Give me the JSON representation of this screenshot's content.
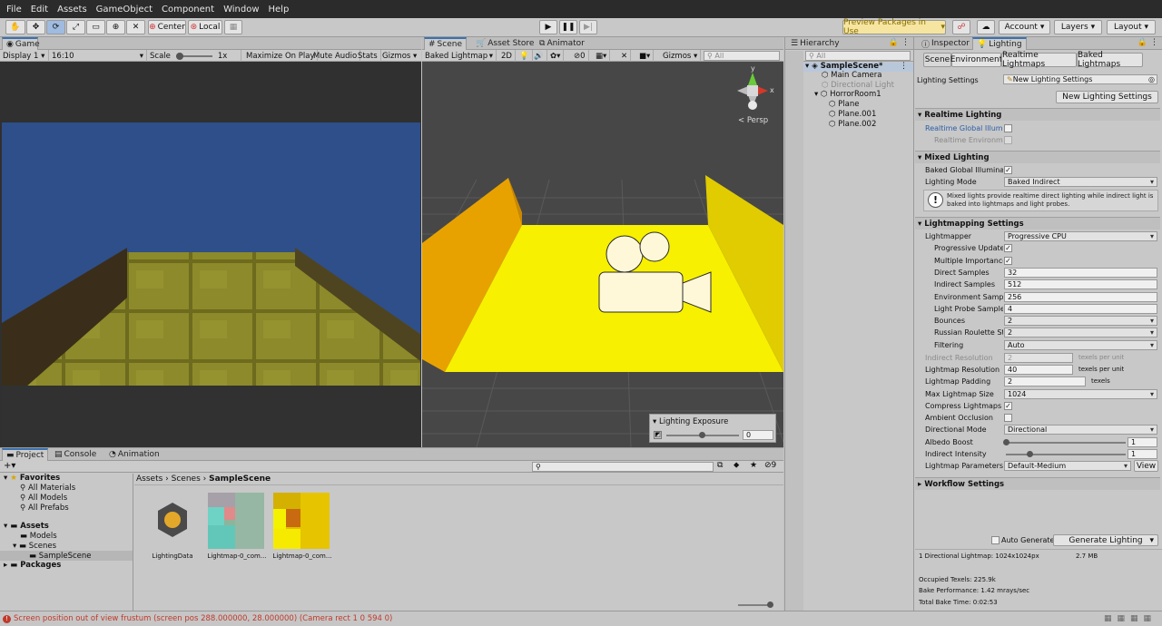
{
  "menu": [
    "File",
    "Edit",
    "Assets",
    "GameObject",
    "Component",
    "Window",
    "Help"
  ],
  "toolbar": {
    "pivot": "Center",
    "space": "Local",
    "preview_packages": "Preview Packages in Use",
    "account": "Account",
    "layers": "Layers",
    "layout": "Layout"
  },
  "game": {
    "tab": "Game",
    "display": "Display 1",
    "aspect": "16:10",
    "scale_label": "Scale",
    "scale_value": "1x",
    "maximize": "Maximize On Play",
    "mute": "Mute Audio",
    "stats": "Stats",
    "gizmos": "Gizmos"
  },
  "scene": {
    "tabs": [
      "Scene",
      "Asset Store",
      "Animator"
    ],
    "draw_mode": "Baked Lightmap",
    "mode_2d": "2D",
    "hidden_count": "0",
    "gizmos": "Gizmos",
    "search_placeholder": "All",
    "persp": "Persp",
    "axis_y": "y",
    "axis_x": "x",
    "exposure_title": "Lighting Exposure",
    "exposure_value": "0"
  },
  "hierarchy": {
    "tab": "Hierarchy",
    "search_placeholder": "All",
    "items": [
      {
        "label": "SampleScene*"
      },
      {
        "label": "Main Camera"
      },
      {
        "label": "Directional Light"
      },
      {
        "label": "HorrorRoom1"
      },
      {
        "label": "Plane"
      },
      {
        "label": "Plane.001"
      },
      {
        "label": "Plane.002"
      }
    ]
  },
  "inspector": {
    "tabs": [
      "Inspector",
      "Lighting"
    ],
    "subtabs": [
      "Scene",
      "Environment",
      "Realtime Lightmaps",
      "Baked Lightmaps"
    ],
    "settings_label": "Lighting Settings",
    "settings_value": "New Lighting Settings",
    "new_settings_button": "New Lighting Settings",
    "realtime": {
      "title": "Realtime Lighting",
      "gi": "Realtime Global Illumin",
      "env": "Realtime Environmer"
    },
    "mixed": {
      "title": "Mixed Lighting",
      "baked_gi": "Baked Global Illuminati",
      "mode_label": "Lighting Mode",
      "mode_value": "Baked Indirect",
      "info": "Mixed lights provide realtime direct lighting while indirect light is baked into lightmaps and light probes."
    },
    "lightmapping": {
      "title": "Lightmapping Settings",
      "lightmapper_label": "Lightmapper",
      "lightmapper_value": "Progressive CPU",
      "progressive_updates": "Progressive Updates",
      "multiple_importance": "Multiple Importance",
      "direct_samples_label": "Direct Samples",
      "direct_samples": "32",
      "indirect_samples_label": "Indirect Samples",
      "indirect_samples": "512",
      "environment_samples_label": "Environment Sample",
      "environment_samples": "256",
      "light_probe_label": "Light Probe Sample",
      "light_probe": "4",
      "bounces_label": "Bounces",
      "bounces": "2",
      "russian_label": "Russian Roulette Sta",
      "russian": "2",
      "filtering_label": "Filtering",
      "filtering": "Auto",
      "indirect_res_label": "Indirect Resolution",
      "indirect_res": "2",
      "texels_per_unit": "texels per unit",
      "lightmap_res_label": "Lightmap Resolution",
      "lightmap_res": "40",
      "lightmap_res_unit": "texels per unit",
      "padding_label": "Lightmap Padding",
      "padding": "2",
      "padding_unit": "texels",
      "max_size_label": "Max Lightmap Size",
      "max_size": "1024",
      "compress_label": "Compress Lightmaps",
      "ao_label": "Ambient Occlusion",
      "directional_label": "Directional Mode",
      "directional": "Directional",
      "albedo_label": "Albedo Boost",
      "albedo": "1",
      "albedo_fraction": 0.0,
      "indirect_int_label": "Indirect Intensity",
      "indirect_int": "1",
      "indirect_int_fraction": 0.2,
      "params_label": "Lightmap Parameters",
      "params": "Default-Medium",
      "view": "View"
    },
    "workflow": "Workflow Settings",
    "auto_generate": "Auto Generate",
    "generate": "Generate Lighting",
    "stats_lightmap": "1 Directional Lightmap: 1024x1024px",
    "stats_size": "2.7 MB",
    "occupied": "Occupied Texels: 225.9k",
    "bake_perf": "Bake Performance: 1.42 mrays/sec",
    "bake_time": "Total Bake Time: 0:02:53"
  },
  "project": {
    "tabs": [
      "Project",
      "Console",
      "Animation"
    ],
    "hidden_count": "9",
    "favorites": "Favorites",
    "fav_items": [
      "All Materials",
      "All Models",
      "All Prefabs"
    ],
    "assets": "Assets",
    "models": "Models",
    "scenes": "Scenes",
    "samplescene": "SampleScene",
    "packages": "Packages",
    "breadcrumb": [
      "Assets",
      "Scenes",
      "SampleScene"
    ],
    "files": [
      "LightingData",
      "Lightmap-0_com...",
      "Lightmap-0_com..."
    ]
  },
  "status": "Screen position out of view frustum (screen pos 288.000000, 28.000000) (Camera rect 1 0 594 0)",
  "colors": {
    "accent": "#3a72b0",
    "sky": "#2e4f8a",
    "yellow": "#f7f000",
    "error": "#c0392b"
  }
}
